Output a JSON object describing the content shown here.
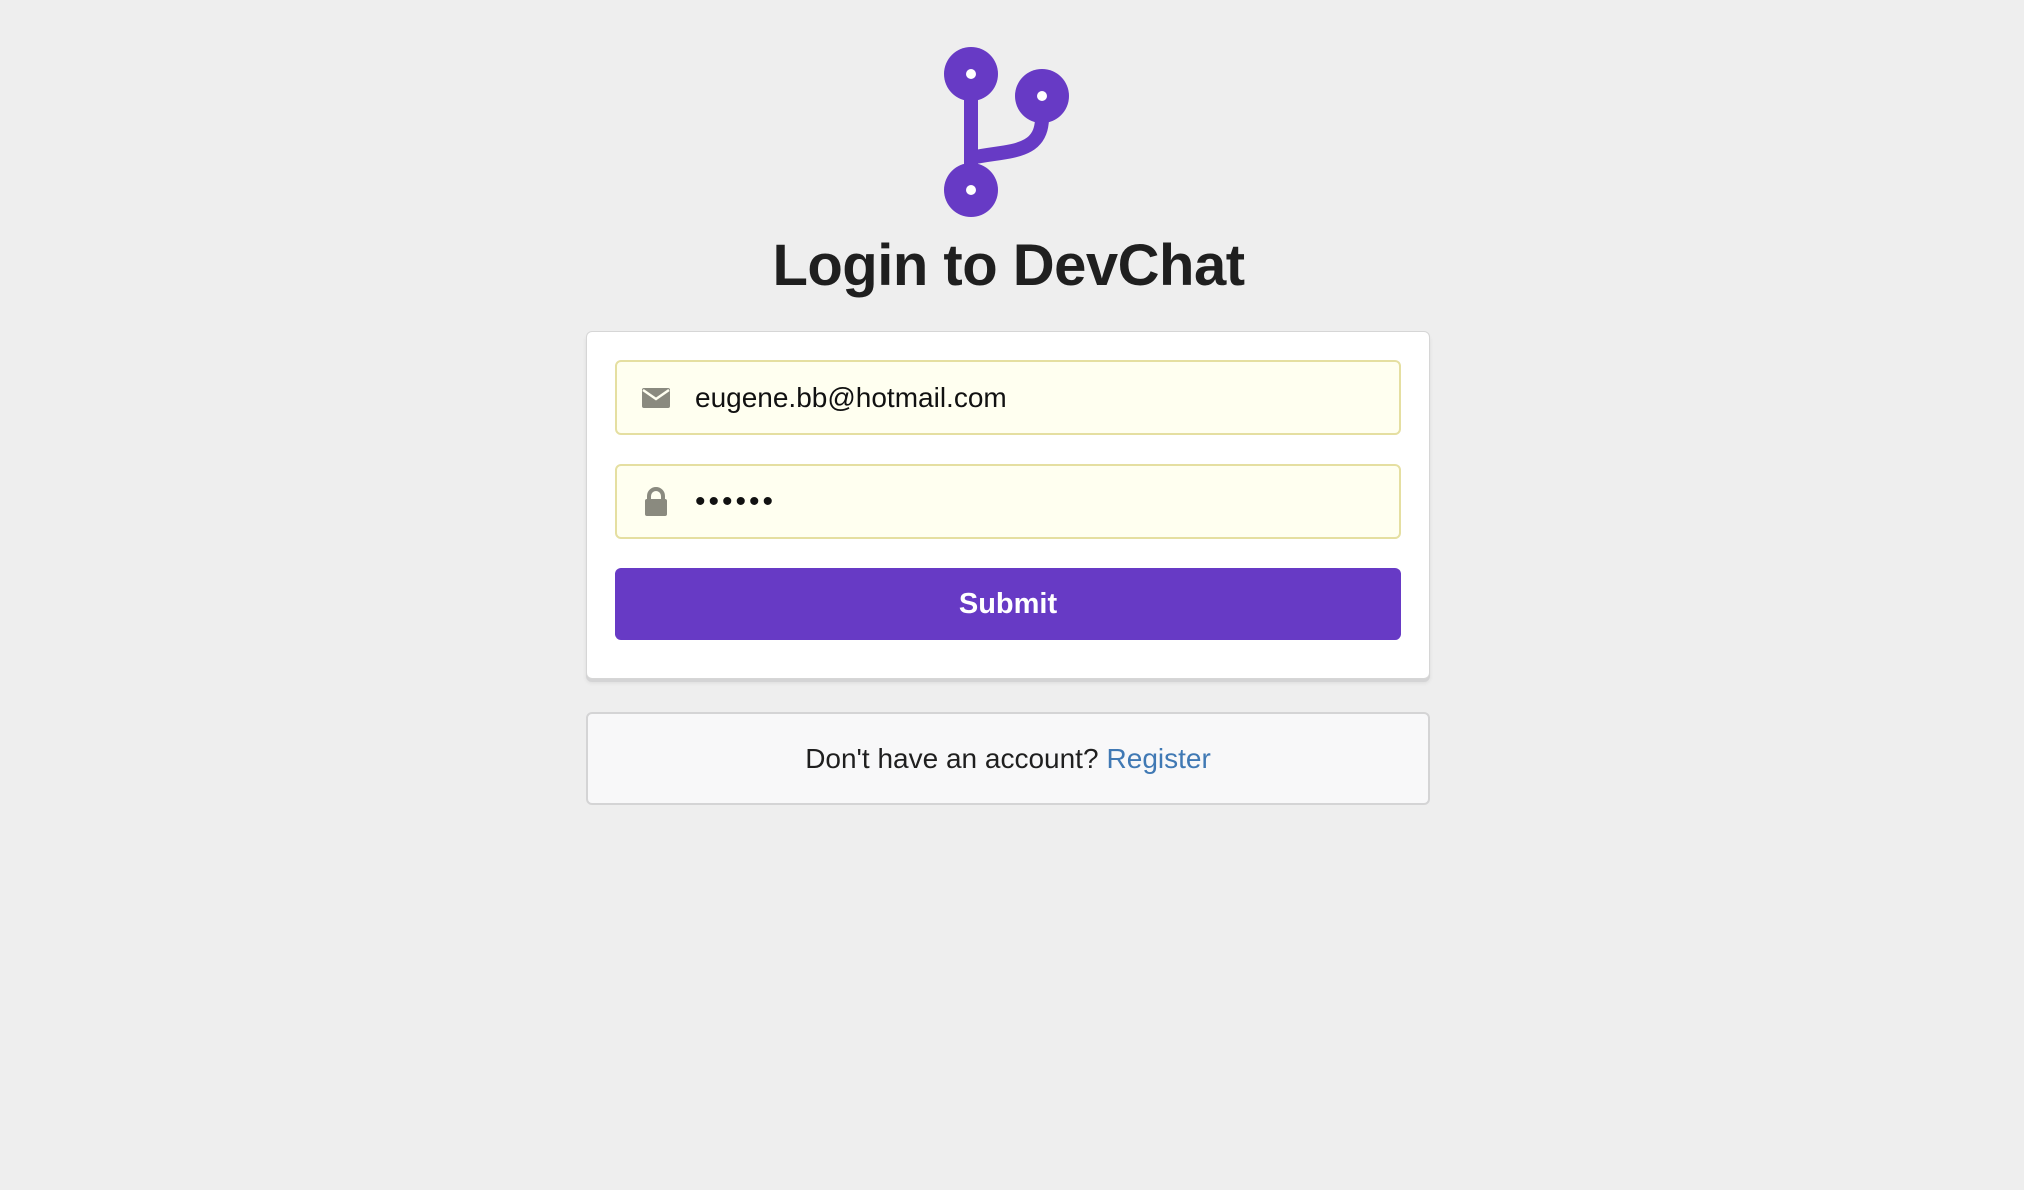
{
  "header": {
    "title": "Login to DevChat",
    "logo_icon": "code-branch-icon",
    "brand_color": "#673ac5"
  },
  "form": {
    "email": {
      "icon": "envelope-icon",
      "value": "eugene.bb@hotmail.com"
    },
    "password": {
      "icon": "lock-icon",
      "value": "••••••"
    },
    "submit_label": "Submit"
  },
  "footer": {
    "prompt": "Don't have an account?",
    "link_label": "Register",
    "link_color": "#4079b4"
  }
}
